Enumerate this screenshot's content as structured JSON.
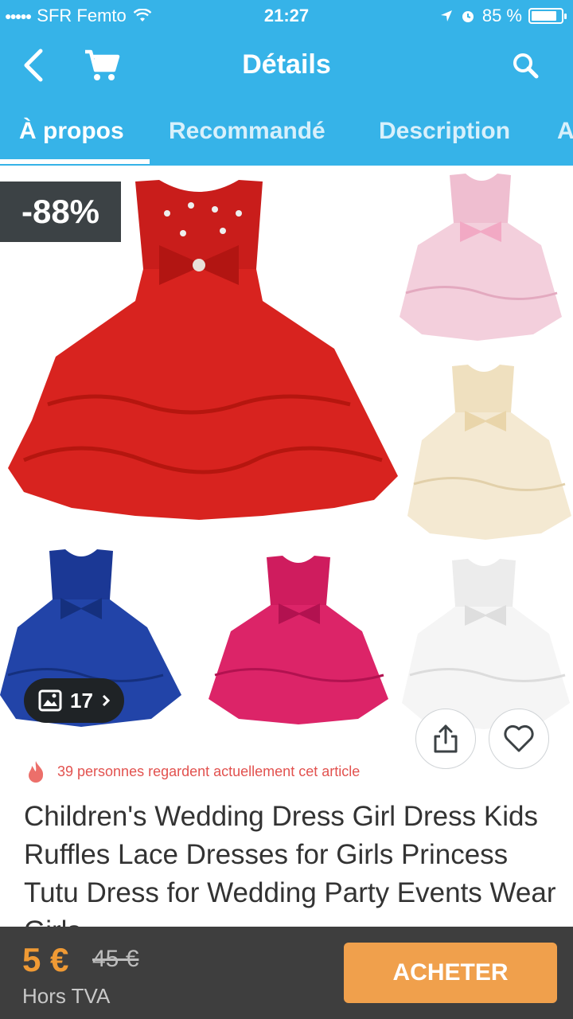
{
  "status_bar": {
    "carrier": "SFR Femto",
    "time": "21:27",
    "battery_percent": "85 %",
    "battery_level": 0.85
  },
  "header": {
    "title": "Détails",
    "icons": [
      "back-arrow-icon",
      "cart-icon",
      "search-icon"
    ]
  },
  "tabs": [
    {
      "label": "À propos",
      "active": true
    },
    {
      "label": "Recommandé",
      "active": false
    },
    {
      "label": "Description",
      "active": false
    },
    {
      "label": "A",
      "active": false
    }
  ],
  "gallery": {
    "discount": "-88%",
    "photo_count": "17",
    "colors": {
      "main": "#d8231f",
      "thumb_pink": "#f1c6d6",
      "thumb_champagne": "#f2e6cc",
      "thumb_blue": "#1f3e9e",
      "thumb_fuchsia": "#d81f63",
      "thumb_white": "#f4f4f4"
    }
  },
  "product": {
    "watchers_text": "39 personnes regardent actuellement cet article",
    "title": "Children's Wedding Dress Girl Dress Kids Ruffles Lace Dresses for Girls Princess Tutu Dress for Wedding Party Events Wear Girls"
  },
  "purchase": {
    "price": "5 €",
    "old_price": "45 €",
    "vat_note": "Hors TVA",
    "buy_label": "ACHETER"
  },
  "theme": {
    "primary": "#36b3e8",
    "accent": "#f0a04c",
    "bottom_bar": "#3e3e3e"
  }
}
